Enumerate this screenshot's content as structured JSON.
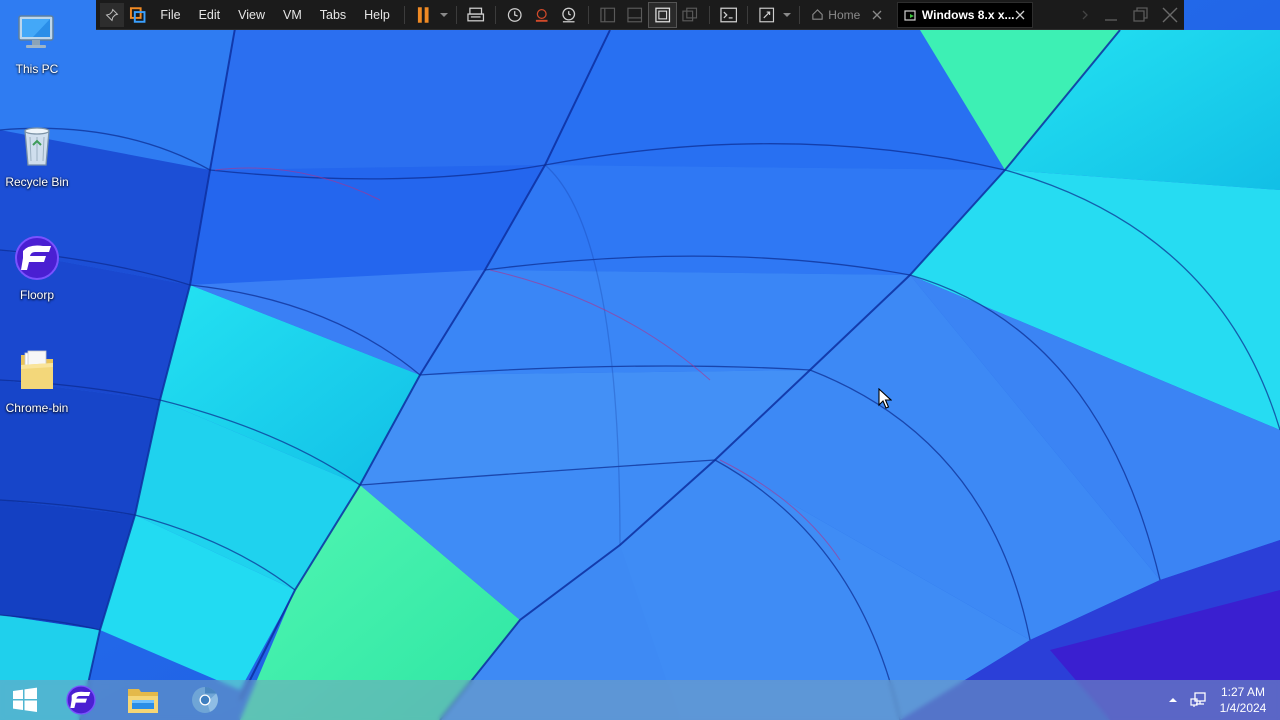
{
  "desktop": {
    "icons": [
      {
        "label": "This PC",
        "icon": "this-pc-icon"
      },
      {
        "label": "Recycle Bin",
        "icon": "recycle-bin-icon"
      },
      {
        "label": "Floorp",
        "icon": "floorp-icon"
      },
      {
        "label": "Chrome-bin",
        "icon": "folder-icon"
      }
    ]
  },
  "vm_toolbar": {
    "menus": [
      "File",
      "Edit",
      "View",
      "VM",
      "Tabs",
      "Help"
    ],
    "tabs": [
      {
        "label": "Home",
        "icon": "home-icon",
        "active": false
      },
      {
        "label": "Windows 8.x x...",
        "icon": "vm-running-icon",
        "active": true
      }
    ]
  },
  "taskbar": {
    "apps": [
      {
        "icon": "windows-start-icon"
      },
      {
        "icon": "floorp-icon"
      },
      {
        "icon": "file-explorer-icon"
      },
      {
        "icon": "chromium-icon"
      }
    ],
    "clock": {
      "time": "1:27 AM",
      "date": "1/4/2024"
    }
  },
  "colors": {
    "accent_orange": "#f08a24",
    "toolbar_bg": "#1b1b1b",
    "wallpaper_blue": "#1e64e6",
    "wallpaper_cyan": "#19d6ea",
    "wallpaper_green": "#3ef0b0"
  }
}
